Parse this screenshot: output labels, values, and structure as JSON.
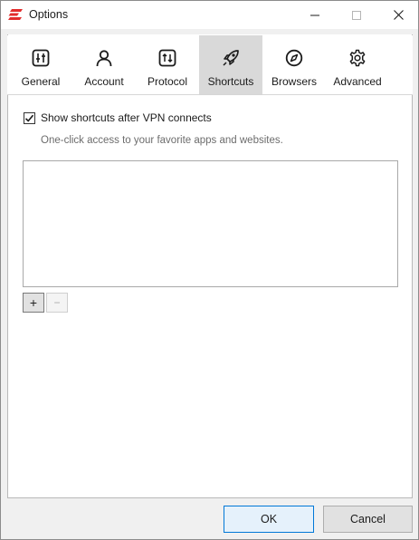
{
  "window": {
    "title": "Options",
    "brand_color": "#e22c2c",
    "controls": [
      "minimize-icon",
      "maximize-icon",
      "close-icon"
    ]
  },
  "tabs": [
    {
      "label": "General",
      "icon": "sliders-icon",
      "active": false
    },
    {
      "label": "Account",
      "icon": "user-icon",
      "active": false
    },
    {
      "label": "Protocol",
      "icon": "protocol-icon",
      "active": false
    },
    {
      "label": "Shortcuts",
      "icon": "rocket-icon",
      "active": true
    },
    {
      "label": "Browsers",
      "icon": "compass-icon",
      "active": false
    },
    {
      "label": "Advanced",
      "icon": "gear-icon",
      "active": false
    }
  ],
  "shortcuts": {
    "checkbox_label": "Show shortcuts after VPN connects",
    "checkbox_checked": true,
    "description": "One-click access to your favorite apps and websites.",
    "items": [],
    "add_label": "+",
    "remove_label": "−",
    "remove_enabled": false
  },
  "footer": {
    "ok_label": "OK",
    "cancel_label": "Cancel"
  }
}
